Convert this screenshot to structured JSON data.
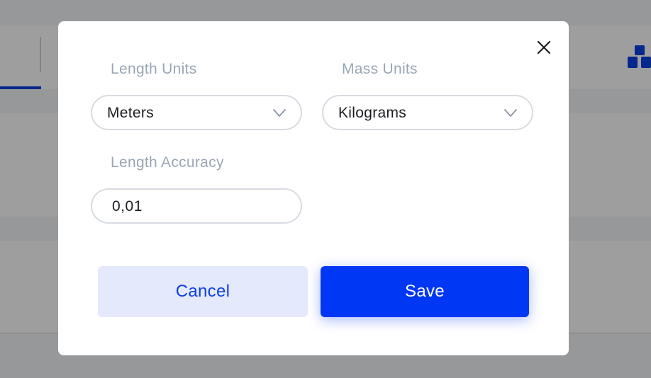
{
  "modal": {
    "length_units": {
      "label": "Length Units",
      "value": "Meters"
    },
    "mass_units": {
      "label": "Mass Units",
      "value": "Kilograms"
    },
    "length_accuracy": {
      "label": "Length Accuracy",
      "value": "0,01"
    },
    "cancel_label": "Cancel",
    "save_label": "Save",
    "close_icon": "close-icon"
  },
  "colors": {
    "accent": "#0037f5",
    "cancel_bg": "#e5e9fc",
    "label": "#9aa6b5",
    "border": "#d7dbe2",
    "overlay": "rgba(0,0,0,0.38)"
  },
  "background": {
    "icon": "boxes-icon"
  }
}
